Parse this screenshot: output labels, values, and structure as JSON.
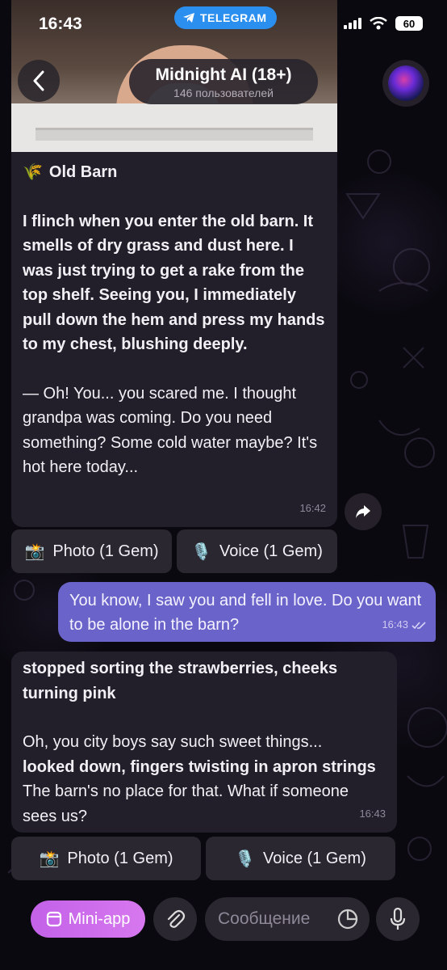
{
  "status_bar": {
    "time": "16:43",
    "app_pill": "TELEGRAM",
    "battery": "60"
  },
  "header": {
    "title": "Midnight AI (18+)",
    "subtitle": "146 пользователей",
    "avatar_icon": "brain-avatar-icon"
  },
  "messages": {
    "m1": {
      "heading_emoji": "🌾",
      "heading": "Old Barn",
      "para1": "I flinch when you enter the old barn. It smells of dry grass and dust here. I was just trying to get a rake from the top shelf. Seeing you, I immediately pull down the hem and press my hands to my chest, blushing deeply.",
      "para2": "— Oh! You... you scared me. I thought grandpa was coming. Do you need something? Some cold water maybe? It's hot here today...",
      "time": "16:42"
    },
    "kb1": {
      "photo": "Photo (1 Gem)",
      "voice": "Voice (1 Gem)"
    },
    "outgoing": {
      "text": "You know, I saw you and fell in love. Do you want to be alone in the barn?",
      "time": "16:43"
    },
    "m2": {
      "bold1": "stopped sorting the strawberries, cheeks turning pink",
      "text1": "Oh, you city boys say such sweet things...",
      "bold2": "looked down, fingers twisting in apron strings",
      "text2": " The barn's no place for that. What if someone sees us?",
      "time": "16:43"
    },
    "kb2": {
      "photo": "Photo (1 Gem)",
      "voice": "Voice (1 Gem)"
    }
  },
  "input": {
    "mini_app_label": "Mini-app",
    "placeholder": "Сообщение"
  },
  "colors": {
    "background": "#0b0910",
    "bubble_in": "#221f2a",
    "bubble_out": "#6a63c9",
    "accent_telegram": "#2b8ff0",
    "mini_app": "#c361e8"
  }
}
